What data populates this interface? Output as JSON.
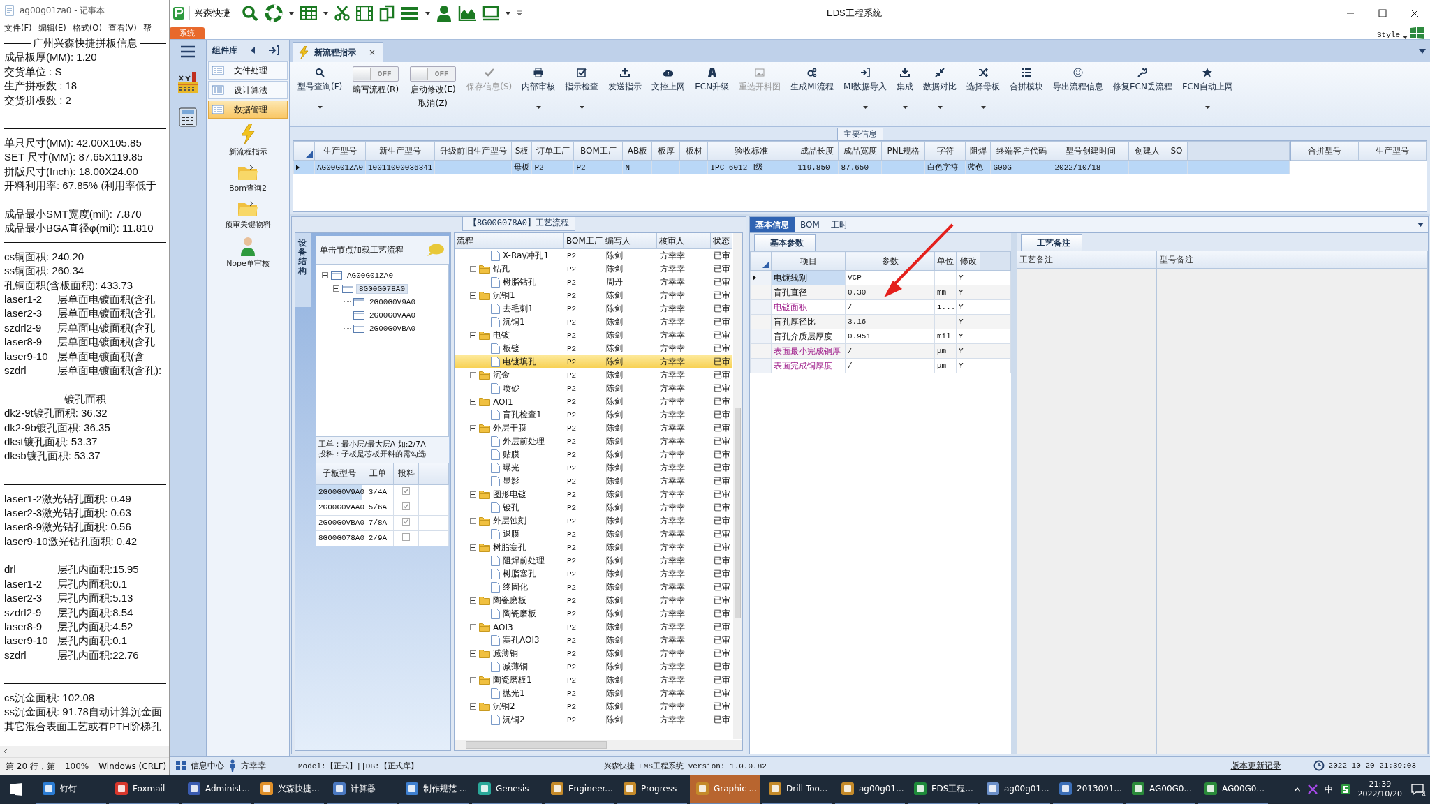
{
  "notepad": {
    "title": "ag00g01za0 - 记事本",
    "menu": [
      "文件(F)",
      "编辑(E)",
      "格式(O)",
      "查看(V)",
      "帮"
    ],
    "lines": [
      {
        "kind": "heading",
        "text": "广州兴森快捷拼板信息"
      },
      {
        "kind": "text",
        "text": "成品板厚(MM): 1.20"
      },
      {
        "kind": "text",
        "text": "交货单位 : S"
      },
      {
        "kind": "text",
        "text": "生产拼板数 : 18"
      },
      {
        "kind": "text",
        "text": "交货拼板数 : 2"
      },
      {
        "kind": "blank"
      },
      {
        "kind": "rule"
      },
      {
        "kind": "text",
        "text": "单只尺寸(MM): 42.00X105.85"
      },
      {
        "kind": "text",
        "text": "SET 尺寸(MM): 87.65X119.85"
      },
      {
        "kind": "text",
        "text": "拼版尺寸(Inch): 18.00X24.00"
      },
      {
        "kind": "text",
        "text": "开料利用率: 67.85% (利用率低于"
      },
      {
        "kind": "rule"
      },
      {
        "kind": "text",
        "text": "成品最小SMT宽度(mil): 7.870"
      },
      {
        "kind": "text",
        "text": "成品最小BGA直径φ(mil):  11.810"
      },
      {
        "kind": "rule"
      },
      {
        "kind": "text",
        "text": "cs铜面积: 240.20"
      },
      {
        "kind": "text",
        "text": "ss铜面积: 260.34"
      },
      {
        "kind": "text",
        "text": "孔铜面积(含板面积): 433.73"
      },
      {
        "kind": "pair",
        "label": "laser1-2",
        "text": "层单面电镀面积(含孔"
      },
      {
        "kind": "pair",
        "label": "laser2-3",
        "text": "层单面电镀面积(含孔"
      },
      {
        "kind": "pair",
        "label": "szdrl2-9",
        "text": "层单面电镀面积(含孔"
      },
      {
        "kind": "pair",
        "label": "laser8-9",
        "text": "层单面电镀面积(含孔"
      },
      {
        "kind": "pair",
        "label": "laser9-10",
        "text": "层单面电镀面积(含"
      },
      {
        "kind": "pair",
        "label": "szdrl",
        "text": "层单面电镀面积(含孔):"
      },
      {
        "kind": "blank"
      },
      {
        "kind": "heading",
        "text": "镀孔面积"
      },
      {
        "kind": "text",
        "text": "dk2-9t镀孔面积: 36.32"
      },
      {
        "kind": "text",
        "text": "dk2-9b镀孔面积: 36.35"
      },
      {
        "kind": "text",
        "text": "dkst镀孔面积: 53.37"
      },
      {
        "kind": "text",
        "text": "dksb镀孔面积: 53.37"
      },
      {
        "kind": "blank"
      },
      {
        "kind": "rule"
      },
      {
        "kind": "text",
        "text": "laser1-2激光钻孔面积: 0.49"
      },
      {
        "kind": "text",
        "text": "laser2-3激光钻孔面积: 0.63"
      },
      {
        "kind": "text",
        "text": "laser8-9激光钻孔面积: 0.56"
      },
      {
        "kind": "text",
        "text": "laser9-10激光钻孔面积: 0.42"
      },
      {
        "kind": "rule"
      },
      {
        "kind": "pair",
        "label": "drl",
        "text": "层孔内面积:15.95"
      },
      {
        "kind": "pair",
        "label": "laser1-2",
        "text": "层孔内面积:0.1"
      },
      {
        "kind": "pair",
        "label": "laser2-3",
        "text": "层孔内面积:5.13"
      },
      {
        "kind": "pair",
        "label": "szdrl2-9",
        "text": "层孔内面积:8.54"
      },
      {
        "kind": "pair",
        "label": "laser8-9",
        "text": "层孔内面积:4.52"
      },
      {
        "kind": "pair",
        "label": "laser9-10",
        "text": "层孔内面积:0.1"
      },
      {
        "kind": "pair",
        "label": "szdrl",
        "text": "层孔内面积:22.76"
      },
      {
        "kind": "blank"
      },
      {
        "kind": "rule"
      },
      {
        "kind": "text",
        "text": "cs沉金面积: 102.08"
      },
      {
        "kind": "text",
        "text": "ss沉金面积: 91.78自动计算沉金面"
      },
      {
        "kind": "text",
        "text": "其它混合表面工艺或有PTH阶梯孔"
      }
    ],
    "status": [
      "第 20 行，第",
      "100%",
      "Windows (CRLF)"
    ]
  },
  "window": {
    "app_name": "兴森快捷",
    "title": "EDS工程系统",
    "style_label": "Style",
    "system_tab": "系统"
  },
  "component_library": {
    "title": "组件库",
    "items": [
      {
        "label": "文件处理",
        "selected": false
      },
      {
        "label": "设计算法",
        "selected": false
      },
      {
        "label": "数据管理",
        "selected": true
      }
    ],
    "tools": [
      "新流程指示",
      "Bom查询2",
      "预审关键物料",
      "Nope单审核"
    ]
  },
  "document_tab": {
    "label": "新流程指示",
    "close": "×"
  },
  "ribbon": [
    {
      "kind": "button",
      "label": "型号查询(F)",
      "dropdown": true,
      "disabled": false
    },
    {
      "kind": "toggle",
      "label": "编写流程(R)",
      "state_text": "OFF",
      "on": false
    },
    {
      "kind": "toggle",
      "label": "启动修改(E)",
      "label2": "取消(Z)",
      "state_text": "OFF",
      "on": false
    },
    {
      "kind": "button",
      "label": "保存信息(S)",
      "dropdown": false,
      "disabled": true
    },
    {
      "kind": "button",
      "label": "内部审核",
      "dropdown": true,
      "disabled": false
    },
    {
      "kind": "button",
      "label": "指示检查",
      "dropdown": true,
      "disabled": false
    },
    {
      "kind": "button",
      "label": "发送指示",
      "dropdown": false,
      "disabled": false
    },
    {
      "kind": "button",
      "label": "文控上网",
      "dropdown": false,
      "disabled": false
    },
    {
      "kind": "button",
      "label": "ECN升级",
      "dropdown": false,
      "disabled": false
    },
    {
      "kind": "button",
      "label": "重选开料图",
      "dropdown": false,
      "disabled": true
    },
    {
      "kind": "button",
      "label": "生成MI流程",
      "dropdown": false,
      "disabled": false
    },
    {
      "kind": "button",
      "label": "MI数据导入",
      "dropdown": true,
      "disabled": false
    },
    {
      "kind": "button",
      "label": "集成",
      "dropdown": true,
      "disabled": false
    },
    {
      "kind": "button",
      "label": "数据对比",
      "dropdown": true,
      "disabled": false
    },
    {
      "kind": "button",
      "label": "选择母板",
      "dropdown": true,
      "disabled": false
    },
    {
      "kind": "button",
      "label": "合拼模块",
      "dropdown": false,
      "disabled": false
    },
    {
      "kind": "button",
      "label": "导出流程信息",
      "dropdown": false,
      "disabled": false
    },
    {
      "kind": "button",
      "label": "修复ECN丢流程",
      "dropdown": false,
      "disabled": false
    },
    {
      "kind": "button",
      "label": "ECN自动上网",
      "dropdown": true,
      "disabled": false
    }
  ],
  "main_info": {
    "title": "主要信息",
    "columns": [
      "生产型号",
      "新生产型号",
      "升级前旧生产型号",
      "S板",
      "订单工厂",
      "BOM工厂",
      "AB板",
      "板厚",
      "板材",
      "验收标准",
      "成品长度",
      "成品宽度",
      "PNL规格",
      "字符",
      "阻焊",
      "终端客户代码",
      "型号创建时间",
      "创建人",
      "SO"
    ],
    "rows": [
      {
        "selected": true,
        "cells": [
          "AG00G01ZA0",
          "10011000036341",
          null,
          "母板",
          "P2",
          "P2",
          "N",
          null,
          null,
          "IPC-6012 Ⅱ级",
          "119.850",
          "87.650",
          null,
          "白色字符",
          "蓝色",
          "G00G",
          "2022/10/18",
          null,
          null
        ]
      }
    ],
    "side_columns": [
      "合拼型号",
      "生产型号"
    ]
  },
  "process": {
    "title": "【8G00G078A0】工艺流程",
    "side_tab": "设备结构",
    "hint": "单击节点加载工艺流程",
    "tree": [
      {
        "label": "AG00G01ZA0",
        "expanded": true,
        "selected": false,
        "children": [
          {
            "label": "8G00G078A0",
            "expanded": true,
            "selected": true,
            "children": [
              {
                "label": "2G00G0V9A0",
                "selected": false
              },
              {
                "label": "2G00G0VAA0",
                "selected": false
              },
              {
                "label": "2G00G0VBA0",
                "selected": false
              }
            ]
          }
        ]
      }
    ],
    "notes": [
      "工单：最小层/最大层A 如:2/7A",
      "投料：子板是芯板开料的需勾选"
    ],
    "sub_columns": [
      "子板型号",
      "工单",
      "投料"
    ],
    "sub_rows": [
      {
        "board": "2G00G0V9A0",
        "order": "3/4A",
        "feed": true,
        "selected": true
      },
      {
        "board": "2G00G0VAA0",
        "order": "5/6A",
        "feed": true,
        "selected": false
      },
      {
        "board": "2G00G0VBA0",
        "order": "7/8A",
        "feed": true,
        "selected": false
      },
      {
        "board": "8G00G078A0",
        "order": "2/9A",
        "feed": false,
        "selected": false
      }
    ]
  },
  "flow": {
    "columns": [
      "流程",
      "BOM工厂",
      "编写人",
      "核审人",
      "状态"
    ],
    "rows": [
      {
        "kind": "step",
        "name": "X-Ray冲孔1",
        "bom": "P2",
        "writer": "陈剑",
        "reviewer": "方幸幸",
        "status": "已审",
        "selected": false
      },
      {
        "kind": "group",
        "name": "钻孔",
        "bom": "P2",
        "writer": "陈剑",
        "reviewer": "方幸幸",
        "status": "已审",
        "selected": false,
        "expanded": true,
        "children": [
          {
            "kind": "step",
            "name": "树脂钻孔",
            "bom": "P2",
            "writer": "周丹",
            "reviewer": "方幸幸",
            "status": "已审",
            "selected": false
          }
        ]
      },
      {
        "kind": "group",
        "name": "沉铜1",
        "bom": "P2",
        "writer": "陈剑",
        "reviewer": "方幸幸",
        "status": "已审",
        "selected": false,
        "expanded": true,
        "children": [
          {
            "kind": "step",
            "name": "去毛刺1",
            "bom": "P2",
            "writer": "陈剑",
            "reviewer": "方幸幸",
            "status": "已审",
            "selected": false
          },
          {
            "kind": "step",
            "name": "沉铜1",
            "bom": "P2",
            "writer": "陈剑",
            "reviewer": "方幸幸",
            "status": "已审",
            "selected": false
          }
        ]
      },
      {
        "kind": "group",
        "name": "电镀",
        "bom": "P2",
        "writer": "陈剑",
        "reviewer": "方幸幸",
        "status": "已审",
        "selected": false,
        "expanded": true,
        "children": [
          {
            "kind": "step",
            "name": "板镀",
            "bom": "P2",
            "writer": "陈剑",
            "reviewer": "方幸幸",
            "status": "已审",
            "selected": false
          },
          {
            "kind": "step",
            "name": "电镀填孔",
            "bom": "P2",
            "writer": "陈剑",
            "reviewer": "方幸幸",
            "status": "已审",
            "selected": true
          }
        ]
      },
      {
        "kind": "group",
        "name": "沉金",
        "bom": "P2",
        "writer": "陈剑",
        "reviewer": "方幸幸",
        "status": "已审",
        "selected": false,
        "expanded": true,
        "children": [
          {
            "kind": "step",
            "name": "喷砂",
            "bom": "P2",
            "writer": "陈剑",
            "reviewer": "方幸幸",
            "status": "已审",
            "selected": false
          }
        ]
      },
      {
        "kind": "group",
        "name": "AOI1",
        "bom": "P2",
        "writer": "陈剑",
        "reviewer": "方幸幸",
        "status": "已审",
        "selected": false,
        "expanded": true,
        "children": [
          {
            "kind": "step",
            "name": "盲孔检查1",
            "bom": "P2",
            "writer": "陈剑",
            "reviewer": "方幸幸",
            "status": "已审",
            "selected": false
          }
        ]
      },
      {
        "kind": "group",
        "name": "外层干膜",
        "bom": "P2",
        "writer": "陈剑",
        "reviewer": "方幸幸",
        "status": "已审",
        "selected": false,
        "expanded": true,
        "children": [
          {
            "kind": "step",
            "name": "外层前处理",
            "bom": "P2",
            "writer": "陈剑",
            "reviewer": "方幸幸",
            "status": "已审",
            "selected": false
          },
          {
            "kind": "step",
            "name": "贴膜",
            "bom": "P2",
            "writer": "陈剑",
            "reviewer": "方幸幸",
            "status": "已审",
            "selected": false
          },
          {
            "kind": "step",
            "name": "曝光",
            "bom": "P2",
            "writer": "陈剑",
            "reviewer": "方幸幸",
            "status": "已审",
            "selected": false
          },
          {
            "kind": "step",
            "name": "显影",
            "bom": "P2",
            "writer": "陈剑",
            "reviewer": "方幸幸",
            "status": "已审",
            "selected": false
          }
        ]
      },
      {
        "kind": "group",
        "name": "图形电镀",
        "bom": "P2",
        "writer": "陈剑",
        "reviewer": "方幸幸",
        "status": "已审",
        "selected": false,
        "expanded": true,
        "children": [
          {
            "kind": "step",
            "name": "镀孔",
            "bom": "P2",
            "writer": "陈剑",
            "reviewer": "方幸幸",
            "status": "已审",
            "selected": false
          }
        ]
      },
      {
        "kind": "group",
        "name": "外层蚀刻",
        "bom": "P2",
        "writer": "陈剑",
        "reviewer": "方幸幸",
        "status": "已审",
        "selected": false,
        "expanded": true,
        "children": [
          {
            "kind": "step",
            "name": "退膜",
            "bom": "P2",
            "writer": "陈剑",
            "reviewer": "方幸幸",
            "status": "已审",
            "selected": false
          }
        ]
      },
      {
        "kind": "group",
        "name": "树脂塞孔",
        "bom": "P2",
        "writer": "陈剑",
        "reviewer": "方幸幸",
        "status": "已审",
        "selected": false,
        "expanded": true,
        "children": [
          {
            "kind": "step",
            "name": "阻焊前处理",
            "bom": "P2",
            "writer": "陈剑",
            "reviewer": "方幸幸",
            "status": "已审",
            "selected": false
          },
          {
            "kind": "step",
            "name": "树脂塞孔",
            "bom": "P2",
            "writer": "陈剑",
            "reviewer": "方幸幸",
            "status": "已审",
            "selected": false
          },
          {
            "kind": "step",
            "name": "终固化",
            "bom": "P2",
            "writer": "陈剑",
            "reviewer": "方幸幸",
            "status": "已审",
            "selected": false
          }
        ]
      },
      {
        "kind": "group",
        "name": "陶瓷磨板",
        "bom": "P2",
        "writer": "陈剑",
        "reviewer": "方幸幸",
        "status": "已审",
        "selected": false,
        "expanded": true,
        "children": [
          {
            "kind": "step",
            "name": "陶瓷磨板",
            "bom": "P2",
            "writer": "陈剑",
            "reviewer": "方幸幸",
            "status": "已审",
            "selected": false
          }
        ]
      },
      {
        "kind": "group",
        "name": "AOI3",
        "bom": "P2",
        "writer": "陈剑",
        "reviewer": "方幸幸",
        "status": "已审",
        "selected": false,
        "expanded": true,
        "children": [
          {
            "kind": "step",
            "name": "塞孔AOI3",
            "bom": "P2",
            "writer": "陈剑",
            "reviewer": "方幸幸",
            "status": "已审",
            "selected": false
          }
        ]
      },
      {
        "kind": "group",
        "name": "减薄铜",
        "bom": "P2",
        "writer": "陈剑",
        "reviewer": "方幸幸",
        "status": "已审",
        "selected": false,
        "expanded": true,
        "children": [
          {
            "kind": "step",
            "name": "减薄铜",
            "bom": "P2",
            "writer": "陈剑",
            "reviewer": "方幸幸",
            "status": "已审",
            "selected": false
          }
        ]
      },
      {
        "kind": "group",
        "name": "陶瓷磨板1",
        "bom": "P2",
        "writer": "陈剑",
        "reviewer": "方幸幸",
        "status": "已审",
        "selected": false,
        "expanded": true,
        "children": [
          {
            "kind": "step",
            "name": "抛光1",
            "bom": "P2",
            "writer": "陈剑",
            "reviewer": "方幸幸",
            "status": "已审",
            "selected": false
          }
        ]
      },
      {
        "kind": "group",
        "name": "沉铜2",
        "bom": "P2",
        "writer": "陈剑",
        "reviewer": "方幸幸",
        "status": "已审",
        "selected": false,
        "expanded": true,
        "children": [
          {
            "kind": "step",
            "name": "沉铜2",
            "bom": "P2",
            "writer": "陈剑",
            "reviewer": "方幸幸",
            "status": "已审",
            "selected": false
          }
        ]
      }
    ]
  },
  "detail": {
    "tabs": [
      {
        "label": "基本信息",
        "selected": true
      },
      {
        "label": "BOM",
        "selected": false
      },
      {
        "label": "工时",
        "selected": false
      }
    ],
    "params_tab": "基本参数",
    "params_columns": [
      "项目",
      "参数",
      "单位",
      "修改"
    ],
    "params": [
      {
        "item": "电镀线别",
        "value": "VCP",
        "modify": "Y",
        "flagged": false,
        "selected": true
      },
      {
        "item": "盲孔直径",
        "value": "0.30",
        "unit": "mm",
        "modify": "Y",
        "flagged": false,
        "selected": false
      },
      {
        "item": "电镀面积",
        "value": "/",
        "unit": "i...",
        "modify": "Y",
        "flagged": true,
        "selected": false
      },
      {
        "item": "盲孔厚径比",
        "value": "3.16",
        "modify": "Y",
        "flagged": false,
        "selected": false
      },
      {
        "item": "盲孔介质层厚度",
        "value": "0.951",
        "unit": "mil",
        "modify": "Y",
        "flagged": false,
        "selected": false
      },
      {
        "item": "表面最小完成铜厚",
        "value": "/",
        "unit": "μm",
        "modify": "Y",
        "flagged": true,
        "selected": false
      },
      {
        "item": "表面完成铜厚度",
        "value": "/",
        "unit": "μm",
        "modify": "Y",
        "flagged": true,
        "selected": false
      }
    ],
    "notes_tab": "工艺备注",
    "notes_columns": [
      "工艺备注",
      "型号备注"
    ]
  },
  "status_bar": {
    "info_center": "信息中心",
    "user": "方幸幸",
    "model": "Model:【正式】||DB:【正式库】",
    "version": "兴森快捷 EMS工程系统 Version: 1.0.0.82",
    "changelog": "版本更新记录",
    "datetime": "2022-10-20 21:39:03"
  },
  "taskbar": {
    "items": [
      {
        "label": "钉钉",
        "selected": false
      },
      {
        "label": "Foxmail",
        "selected": false
      },
      {
        "label": "Administ...",
        "selected": false
      },
      {
        "label": "兴森快捷...",
        "selected": false
      },
      {
        "label": "计算器",
        "selected": false
      },
      {
        "label": "制作规范 ...",
        "selected": false
      },
      {
        "label": "Genesis",
        "selected": false
      },
      {
        "label": "Engineer...",
        "selected": false
      },
      {
        "label": "Progress",
        "selected": false
      },
      {
        "label": "Graphic ...",
        "selected": true
      },
      {
        "label": "Drill Too...",
        "selected": false
      },
      {
        "label": "ag00g01...",
        "selected": false
      },
      {
        "label": "EDS工程...",
        "selected": false
      },
      {
        "label": "ag00g01...",
        "selected": false
      },
      {
        "label": "2013091...",
        "selected": false
      },
      {
        "label": "AG00G0...",
        "selected": false
      },
      {
        "label": "AG00G0...",
        "selected": false
      }
    ],
    "ime": "中",
    "time": "21:39",
    "date": "2022/10/20",
    "notifications": "4"
  }
}
